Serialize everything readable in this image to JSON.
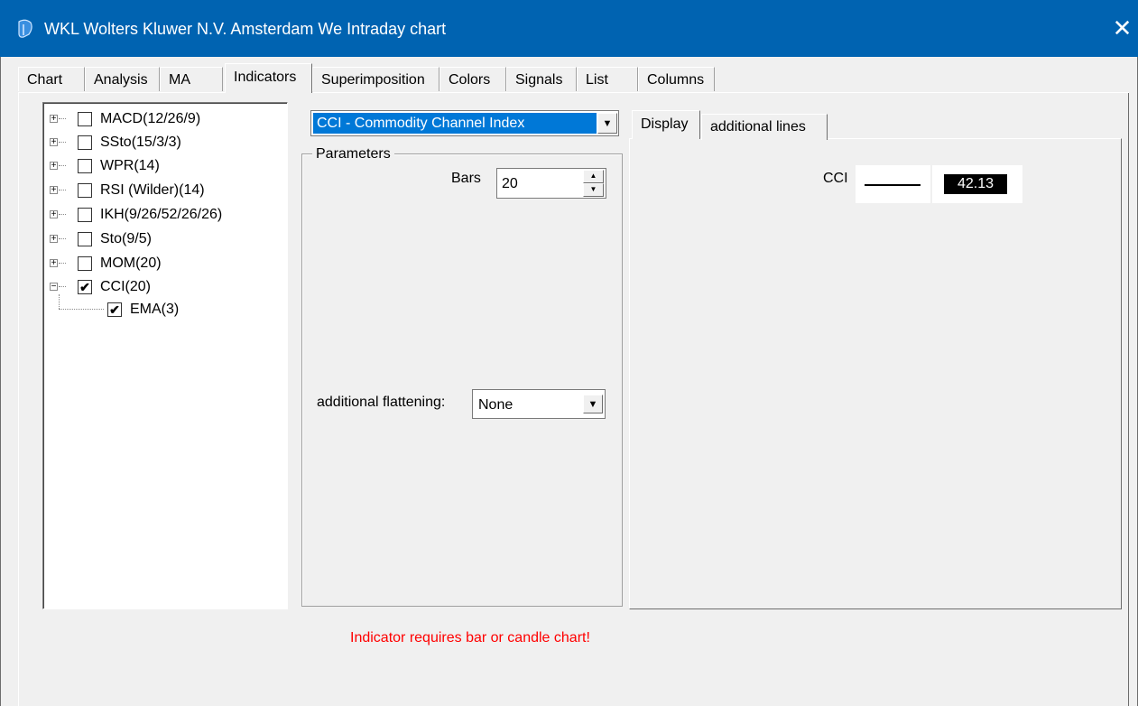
{
  "window": {
    "title": "WKL Wolters Kluwer N.V. Amsterdam We Intraday chart",
    "close_glyph": "✕",
    "icon": "app-logo-icon"
  },
  "tabs": [
    {
      "label": "Chart",
      "active": false
    },
    {
      "label": "Analysis",
      "active": false
    },
    {
      "label": "MA",
      "active": false
    },
    {
      "label": "Indicators",
      "active": true
    },
    {
      "label": "Superimposition",
      "active": false
    },
    {
      "label": "Colors",
      "active": false
    },
    {
      "label": "Signals",
      "active": false
    },
    {
      "label": "List",
      "active": false
    },
    {
      "label": "Columns",
      "active": false
    }
  ],
  "tree": [
    {
      "label": "MACD(12/26/9)",
      "checked": false,
      "expander": "+"
    },
    {
      "label": "SSto(15/3/3)",
      "checked": false,
      "expander": "+"
    },
    {
      "label": "WPR(14)",
      "checked": false,
      "expander": "+"
    },
    {
      "label": "RSI (Wilder)(14)",
      "checked": false,
      "expander": "+"
    },
    {
      "label": "IKH(9/26/52/26/26)",
      "checked": false,
      "expander": "+"
    },
    {
      "label": "Sto(9/5)",
      "checked": false,
      "expander": "+"
    },
    {
      "label": "MOM(20)",
      "checked": false,
      "expander": "+"
    },
    {
      "label": "CCI(20)",
      "checked": true,
      "expander": "−"
    },
    {
      "label": "EMA(3)",
      "checked": true,
      "child": true
    }
  ],
  "indicator_select": {
    "value": "CCI - Commodity Channel Index"
  },
  "parameters": {
    "legend": "Parameters",
    "bars_label": "Bars",
    "bars_value": "20",
    "flattening_label": "additional flattening:",
    "flattening_value": "None"
  },
  "sub_tabs": [
    {
      "label": "Display",
      "active": true
    },
    {
      "label": "additional lines",
      "active": false
    }
  ],
  "display": {
    "cci_label": "CCI",
    "value": "42.13",
    "line_color": "#000000"
  },
  "warning": "Indicator requires bar or candle chart!",
  "colors": {
    "titlebar": "#0063b1",
    "selection": "#0078d7",
    "warning": "#ff0000"
  }
}
